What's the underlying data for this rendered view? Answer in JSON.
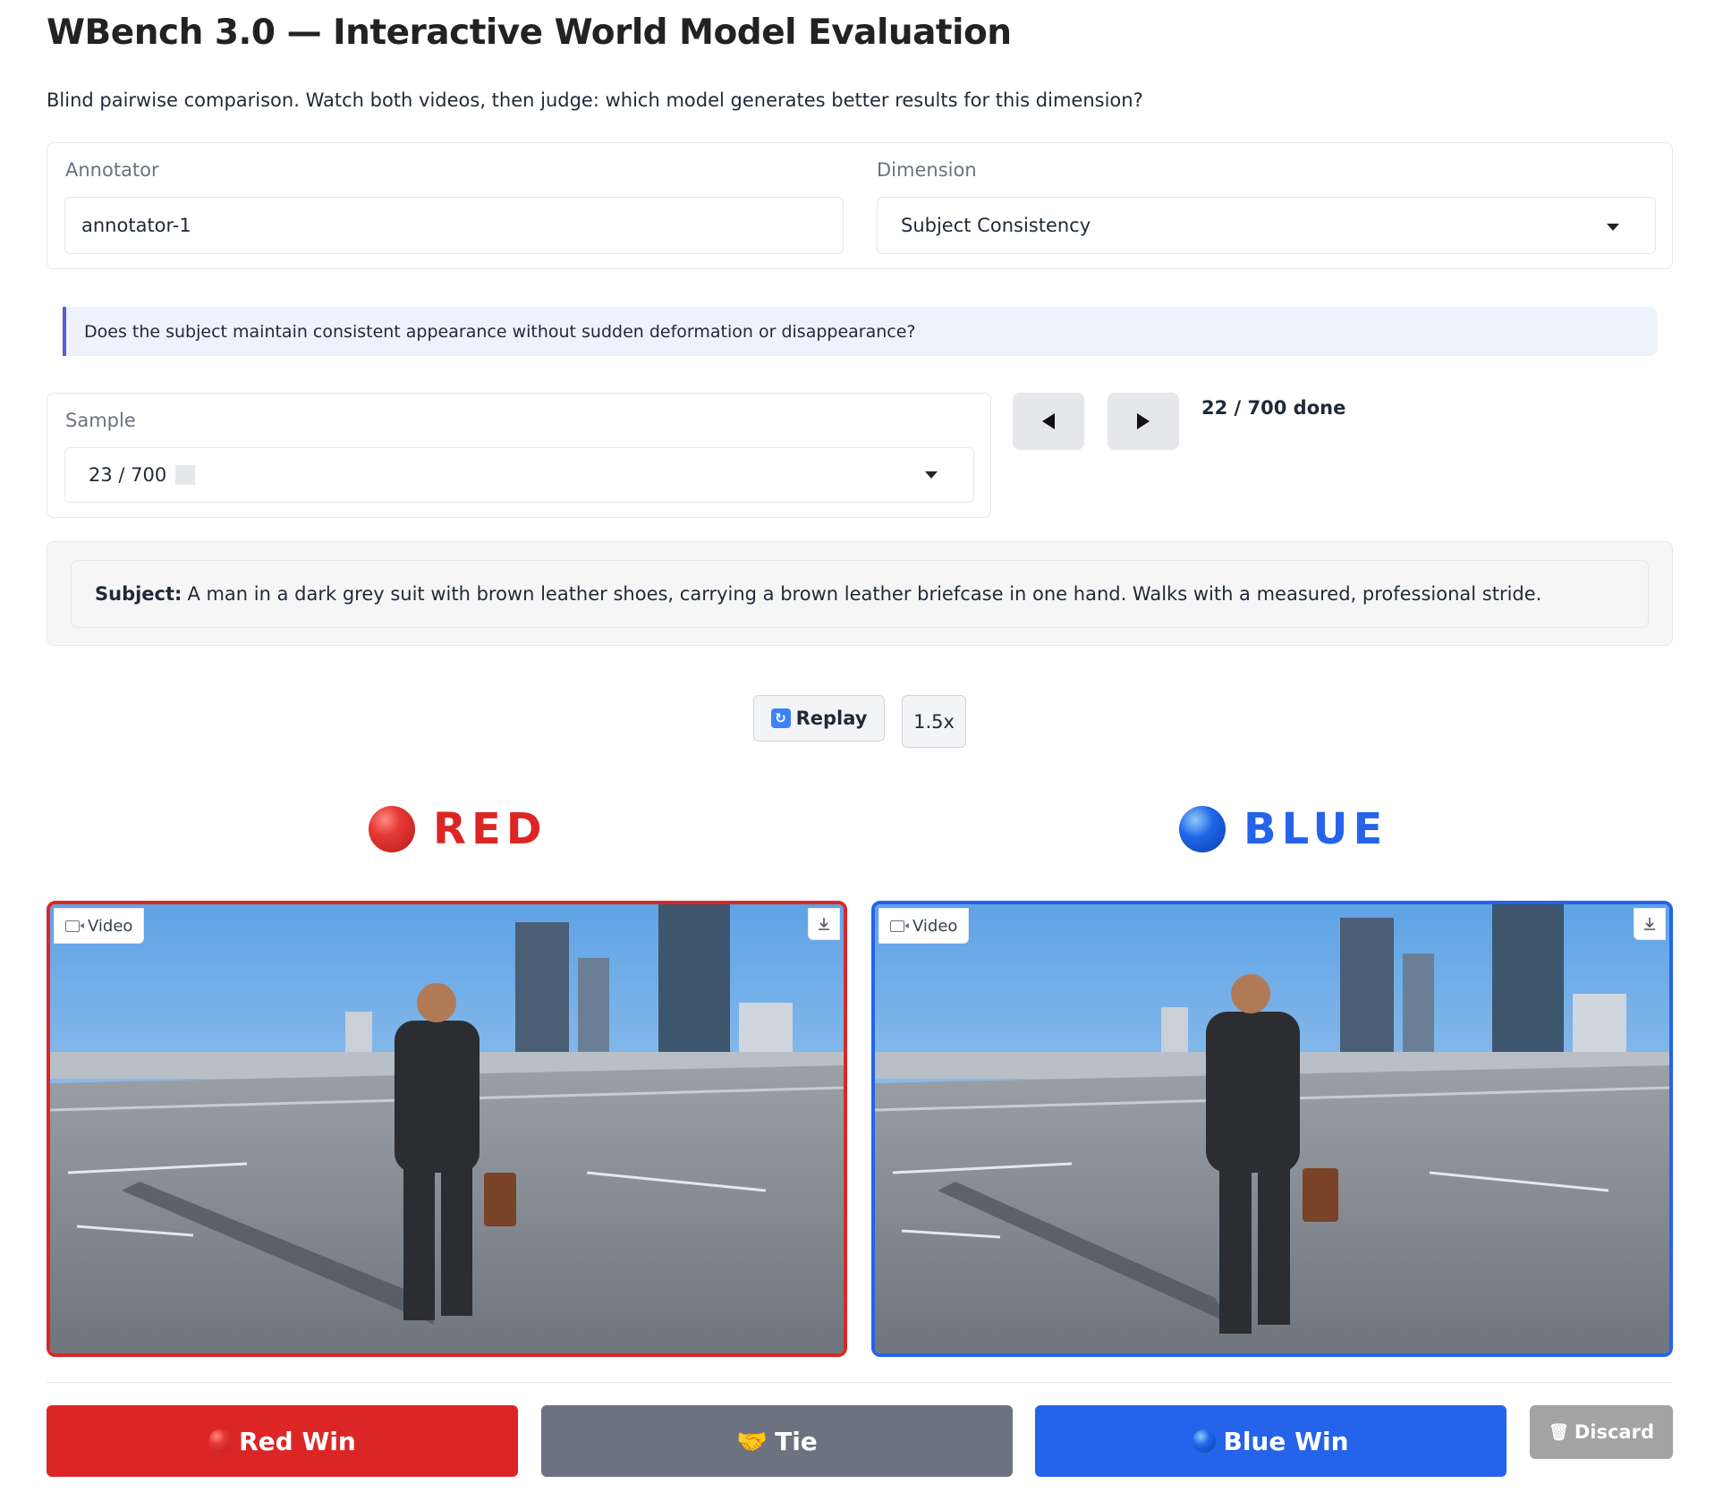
{
  "header": {
    "title": "WBench 3.0 — Interactive World Model Evaluation",
    "subtitle": "Blind pairwise comparison. Watch both videos, then judge: which model generates better results for this dimension?"
  },
  "annotator": {
    "label": "Annotator",
    "value": "annotator-1"
  },
  "dimension": {
    "label": "Dimension",
    "value": "Subject Consistency"
  },
  "question": "Does the subject maintain consistent appearance without sudden deformation or disappearance?",
  "sample": {
    "label": "Sample",
    "value": "23 / 700"
  },
  "navigation": {
    "prev_icon": "triangle-left-icon",
    "next_icon": "triangle-right-icon",
    "progress": "22 / 700 done"
  },
  "subject": {
    "label": "Subject:",
    "text": "A man in a dark grey suit with brown leather shoes, carrying a brown leather briefcase in one hand. Walks with a measured, professional stride."
  },
  "playback": {
    "replay_label": "Replay",
    "speed_label": "1.5x"
  },
  "red": {
    "label": "RED",
    "video_tag": "Video",
    "color": "#dc2626"
  },
  "blue": {
    "label": "BLUE",
    "video_tag": "Video",
    "color": "#2563eb"
  },
  "votes": {
    "red_win": "Red Win",
    "tie": "Tie",
    "blue_win": "Blue Win",
    "discard": "Discard"
  }
}
